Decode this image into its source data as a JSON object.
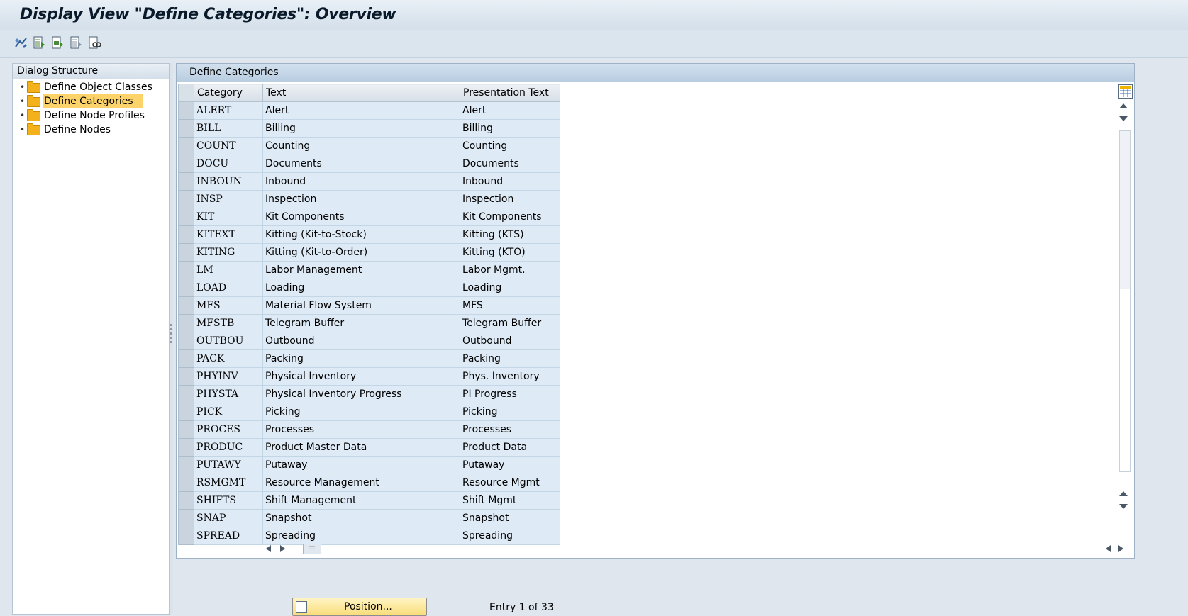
{
  "window": {
    "title": "Display View \"Define Categories\": Overview"
  },
  "toolbar": {
    "buttons": [
      "display-change-icon",
      "select-all-icon",
      "select-block-icon",
      "deselect-all-icon",
      "find-icon"
    ]
  },
  "dialog_structure": {
    "header": "Dialog Structure",
    "items": [
      {
        "label": "Define Object Classes",
        "selected": false
      },
      {
        "label": "Define Categories",
        "selected": true
      },
      {
        "label": "Define Node Profiles",
        "selected": false
      },
      {
        "label": "Define Nodes",
        "selected": false
      }
    ]
  },
  "grid": {
    "title": "Define Categories",
    "columns": [
      "Category",
      "Text",
      "Presentation Text"
    ],
    "rows": [
      [
        "ALERT",
        "Alert",
        "Alert"
      ],
      [
        "BILL",
        "Billing",
        "Billing"
      ],
      [
        "COUNT",
        "Counting",
        "Counting"
      ],
      [
        "DOCU",
        "Documents",
        "Documents"
      ],
      [
        "INBOUN",
        "Inbound",
        "Inbound"
      ],
      [
        "INSP",
        "Inspection",
        "Inspection"
      ],
      [
        "KIT",
        "Kit Components",
        "Kit Components"
      ],
      [
        "KITEXT",
        "Kitting (Kit-to-Stock)",
        "Kitting (KTS)"
      ],
      [
        "KITING",
        "Kitting (Kit-to-Order)",
        "Kitting (KTO)"
      ],
      [
        "LM",
        "Labor Management",
        "Labor Mgmt."
      ],
      [
        "LOAD",
        "Loading",
        "Loading"
      ],
      [
        "MFS",
        "Material Flow System",
        "MFS"
      ],
      [
        "MFSTB",
        "Telegram Buffer",
        "Telegram Buffer"
      ],
      [
        "OUTBOU",
        "Outbound",
        "Outbound"
      ],
      [
        "PACK",
        "Packing",
        "Packing"
      ],
      [
        "PHYINV",
        "Physical Inventory",
        "Phys. Inventory"
      ],
      [
        "PHYSTA",
        "Physical Inventory Progress",
        "PI Progress"
      ],
      [
        "PICK",
        "Picking",
        "Picking"
      ],
      [
        "PROCES",
        "Processes",
        "Processes"
      ],
      [
        "PRODUC",
        "Product Master Data",
        "Product Data"
      ],
      [
        "PUTAWY",
        "Putaway",
        "Putaway"
      ],
      [
        "RSMGMT",
        "Resource Management",
        "Resource Mgmt"
      ],
      [
        "SHIFTS",
        "Shift Management",
        "Shift Mgmt"
      ],
      [
        "SNAP",
        "Snapshot",
        "Snapshot"
      ],
      [
        "SPREAD",
        "Spreading",
        "Spreading"
      ]
    ]
  },
  "footer": {
    "position_button": "Position...",
    "entry_text": "Entry 1 of 33"
  }
}
